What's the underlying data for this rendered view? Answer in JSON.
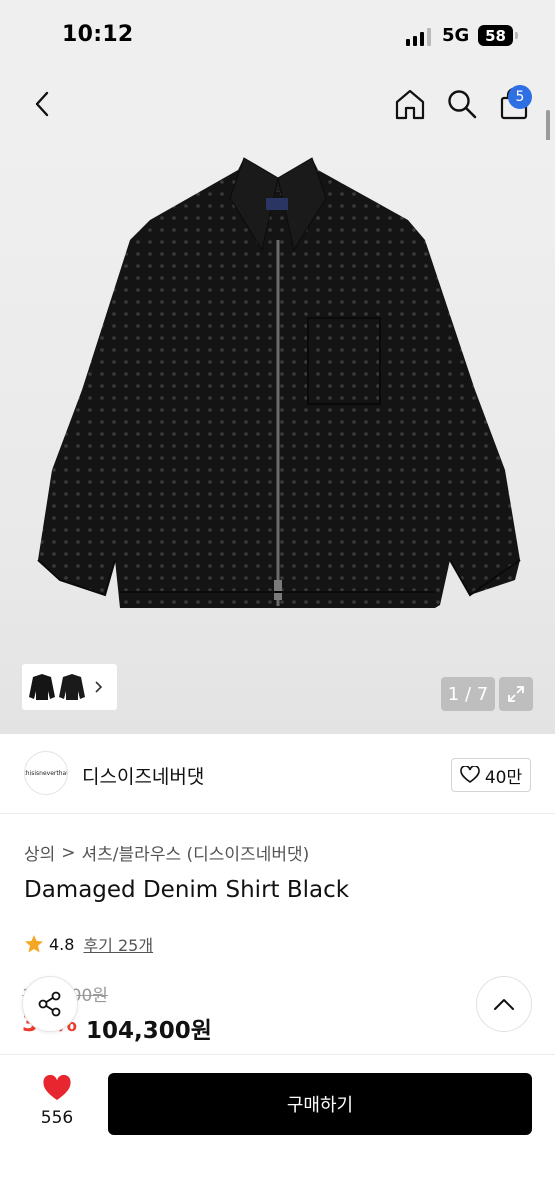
{
  "status_bar": {
    "time": "10:12",
    "network": "5G",
    "battery": "58"
  },
  "nav": {
    "cart_count": "5",
    "icons": [
      "chevron-left-icon",
      "home-icon",
      "search-icon",
      "shopping-bag-icon"
    ]
  },
  "gallery": {
    "page_indicator": "1 / 7",
    "current_page": 1,
    "total_pages": 7
  },
  "brand": {
    "logo_text": "thisisneverthat",
    "name": "디스이즈네버댓",
    "like_count": "40만"
  },
  "breadcrumb": {
    "level1": "상의",
    "separator": ">",
    "level2": "셔츠/블라우스 (디스이즈네버댓)"
  },
  "product": {
    "title": "Damaged Denim Shirt Black",
    "rating": "4.8",
    "reviews_label": "후기 25개",
    "original_price": "149,000원",
    "discount": "30%",
    "sale_price": "104,300원"
  },
  "bottom": {
    "wish_count": "556",
    "buy_label": "구매하기"
  },
  "colors": {
    "accent_blue": "#2f6fe4",
    "discount_red": "#ef3b2d",
    "heart_red": "#e8262f",
    "star": "#f5a623",
    "buy_bg": "#000000"
  }
}
